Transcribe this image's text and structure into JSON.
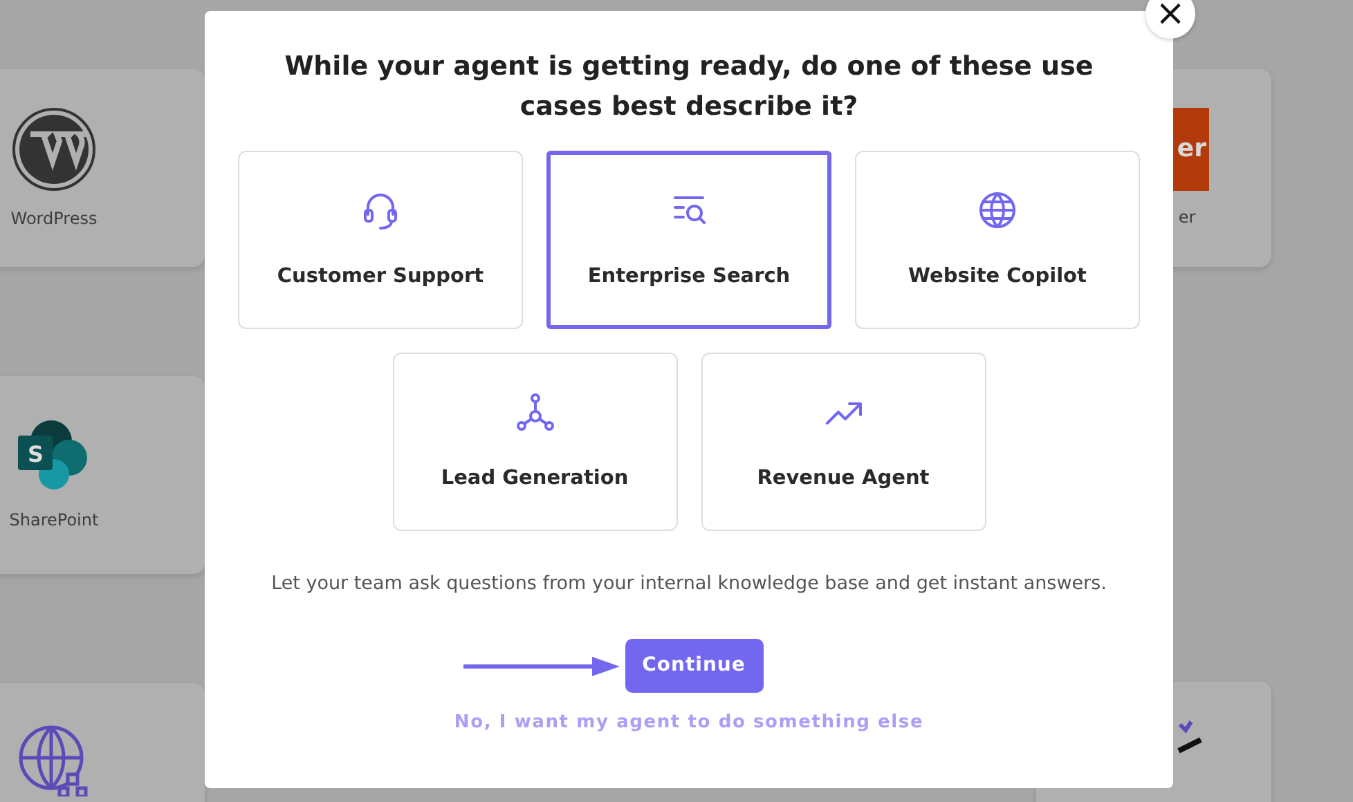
{
  "background": {
    "left_cards": [
      {
        "kind": "wordpress",
        "label": "WordPress"
      },
      {
        "kind": "sharepoint",
        "label": "SharePoint",
        "logo_text": "S"
      },
      {
        "kind": "globe-network"
      }
    ],
    "right_cards": [
      {
        "kind": "orange-logo",
        "logo_text": "er",
        "label": "er"
      },
      {
        "kind": "sketch"
      }
    ]
  },
  "modal": {
    "title": "While your agent is getting ready, do one of these use cases best describe it?",
    "options": [
      {
        "label": "Customer Support",
        "kind": "headset",
        "selected": false
      },
      {
        "label": "Enterprise Search",
        "kind": "search",
        "selected": true
      },
      {
        "label": "Website Copilot",
        "kind": "globe",
        "selected": false
      },
      {
        "label": "Lead Generation",
        "kind": "network",
        "selected": false
      },
      {
        "label": "Revenue Agent",
        "kind": "trend",
        "selected": false
      }
    ],
    "description": "Let your team ask questions from your internal knowledge base and get instant answers.",
    "continue_button": "Continue",
    "alternative_link": "No, I want my agent to do something else",
    "close_button": "×"
  }
}
